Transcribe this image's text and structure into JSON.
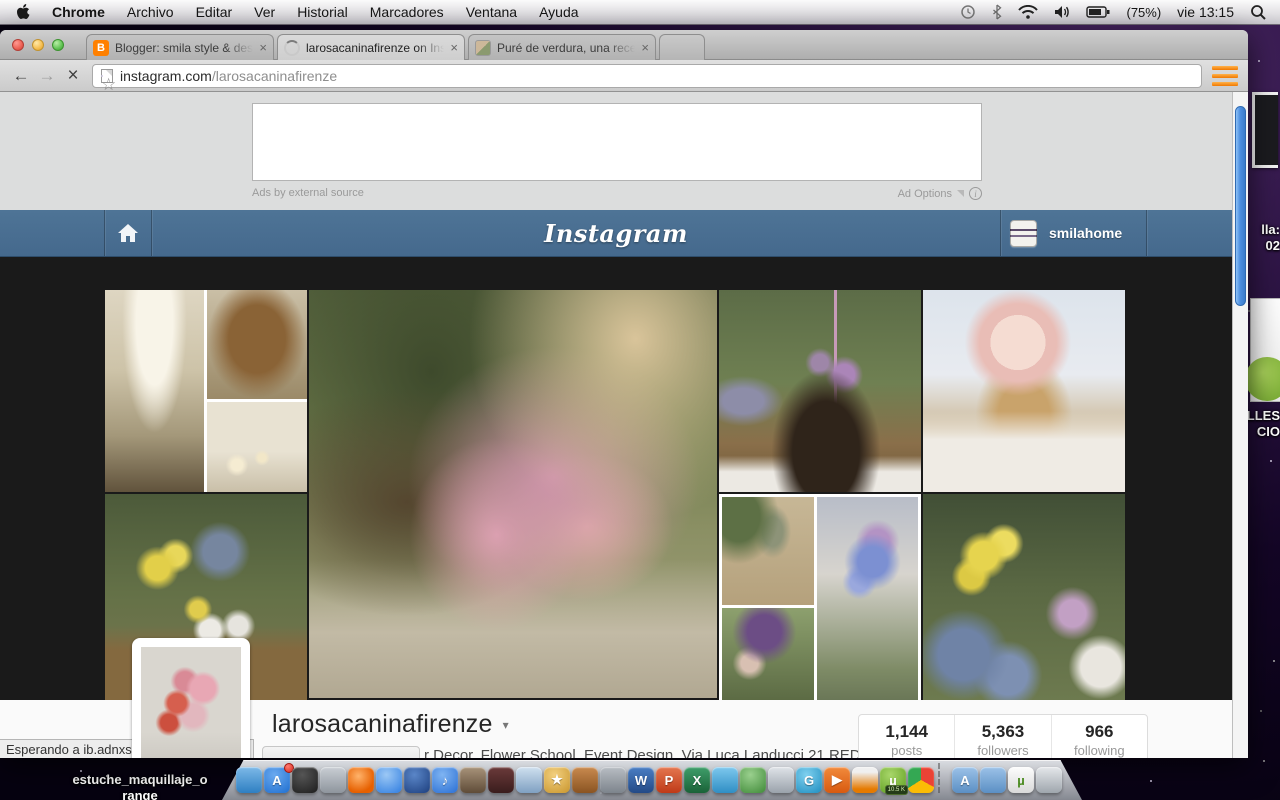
{
  "menu_bar": {
    "items": [
      "Chrome",
      "Archivo",
      "Editar",
      "Ver",
      "Historial",
      "Marcadores",
      "Ventana",
      "Ayuda"
    ],
    "battery_label": "(75%)",
    "clock": "vie 13:15"
  },
  "browser": {
    "tabs": [
      {
        "title": "Blogger: smila style & desi",
        "close": "×"
      },
      {
        "title": "larosacaninafirenze on Ins",
        "close": "×"
      },
      {
        "title": "Puré de verdura, una recet",
        "close": "×"
      }
    ],
    "url_domain": "instagram.com",
    "url_path": "/larosacaninafirenze",
    "back_glyph": "←",
    "forward_glyph": "→",
    "stop_glyph": "×",
    "star_glyph": "☆"
  },
  "ad_banner": {
    "left_label": "Ads by external source",
    "right_label": "Ad Options",
    "info_glyph": "i"
  },
  "instagram": {
    "logo": "Instagram",
    "header_user": "smilahome",
    "header_color": "#45698d",
    "profile": {
      "username": "larosacaninafirenze",
      "caret": "▾",
      "bio_visible": "r Decor, Flower School, Event Design, Via Luca Landucci 21 RED",
      "stats": [
        {
          "value": "1,144",
          "label": "posts"
        },
        {
          "value": "5,363",
          "label": "followers"
        },
        {
          "value": "966",
          "label": "following"
        }
      ]
    }
  },
  "status_bar": {
    "text": "Esperando a ib.adnxs.com..."
  },
  "desktop": {
    "right_label_1": [
      "lla:",
      "02"
    ],
    "right_label_2": [
      "ALLES",
      "CIO"
    ],
    "bottom_label": [
      "estuche_maquillaje_o",
      "range"
    ]
  },
  "dock": {
    "items": [
      {
        "name": "dock-finder",
        "color": "linear-gradient(180deg,#7db9e8,#2e7fc2)"
      },
      {
        "name": "dock-app-store",
        "color": "radial-gradient(circle at 40% 30%,#6aa9ef,#1f6fd0)",
        "glyph": "A",
        "badge": ""
      },
      {
        "name": "dock-dashboard",
        "color": "radial-gradient(circle at 40% 30%,#555,#1d1d1d)"
      },
      {
        "name": "dock-radio-app",
        "color": "linear-gradient(180deg,#c9ced4,#8e959d)"
      },
      {
        "name": "dock-firefox",
        "color": "radial-gradient(circle at 40% 35%,#ffb36b,#e66000 70%)"
      },
      {
        "name": "dock-safari",
        "color": "radial-gradient(circle at 40% 30%,#9cc8f5,#2f7de0)"
      },
      {
        "name": "dock-quicktime",
        "color": "radial-gradient(circle at 40% 30%,#5a86c8,#1d3f7e)"
      },
      {
        "name": "dock-itunes",
        "color": "radial-gradient(circle at 40% 30%,#7fb4f2,#2a6fd4)",
        "glyph": "♪"
      },
      {
        "name": "dock-photo-booth",
        "color": "linear-gradient(180deg,#a8937a,#5f4c38)"
      },
      {
        "name": "dock-imovie",
        "color": "linear-gradient(180deg,#6b3a3a,#3a1d1d)"
      },
      {
        "name": "dock-iphoto",
        "color": "linear-gradient(180deg,#cfe0ef,#7fa0c2)"
      },
      {
        "name": "dock-star-app",
        "color": "radial-gradient(circle at 40% 30%,#f2cf7e,#c9962e)",
        "glyph": "★"
      },
      {
        "name": "dock-garageband",
        "color": "linear-gradient(180deg,#c98a4f,#8a5422)"
      },
      {
        "name": "dock-system-preferences",
        "color": "linear-gradient(180deg,#b8bdc3,#7d848c)"
      },
      {
        "name": "dock-word",
        "color": "linear-gradient(180deg,#4a7ec4,#234a86)",
        "glyph": "W"
      },
      {
        "name": "dock-powerpoint",
        "color": "linear-gradient(180deg,#e4764f,#bf3a18)",
        "glyph": "P"
      },
      {
        "name": "dock-excel",
        "color": "linear-gradient(180deg,#3f9e6a,#1a6238)",
        "glyph": "X"
      },
      {
        "name": "dock-messenger",
        "color": "linear-gradient(180deg,#7ec8ee,#2f8ec4)"
      },
      {
        "name": "dock-download-globe",
        "color": "radial-gradient(circle at 40% 30%,#9ad08e,#3f8a38)"
      },
      {
        "name": "dock-satellite-app",
        "color": "linear-gradient(180deg,#dfe3e8,#9aa2ab)"
      },
      {
        "name": "dock-g-lite-app",
        "color": "radial-gradient(circle at 40% 30%,#7fd0ef,#1f8ec0)",
        "glyph": "G"
      },
      {
        "name": "dock-orange-player",
        "color": "linear-gradient(180deg,#f28a3c,#d85a10)",
        "glyph": "▶"
      },
      {
        "name": "dock-vlc",
        "color": "linear-gradient(180deg,#f0f0f0 20%,#e57a00 85%)"
      },
      {
        "name": "dock-utorrent",
        "color": "radial-gradient(circle at 40% 30%,#a8d66a,#5f9e1f)",
        "glyph": "µ",
        "badge_text": "10.5 K"
      },
      {
        "name": "dock-chrome",
        "color": "conic-gradient(#ea4335 0 33%, #fbbc05 33% 66%, #34a853 66%)"
      },
      {
        "name": "dock-divider",
        "type": "divider"
      },
      {
        "name": "dock-applications-folder",
        "color": "linear-gradient(180deg,#9cc2e8,#5b8fc4)",
        "glyph": "A"
      },
      {
        "name": "dock-documents-folder",
        "color": "linear-gradient(180deg,#9cc2e8,#5b8fc4)"
      },
      {
        "name": "dock-torrent-file",
        "color": "linear-gradient(180deg,#fdfdfd,#d9d9d9)",
        "glyph_dark": "µ"
      },
      {
        "name": "dock-trash",
        "color": "linear-gradient(180deg,#e4e7ea,#9fa6ad)"
      }
    ]
  }
}
